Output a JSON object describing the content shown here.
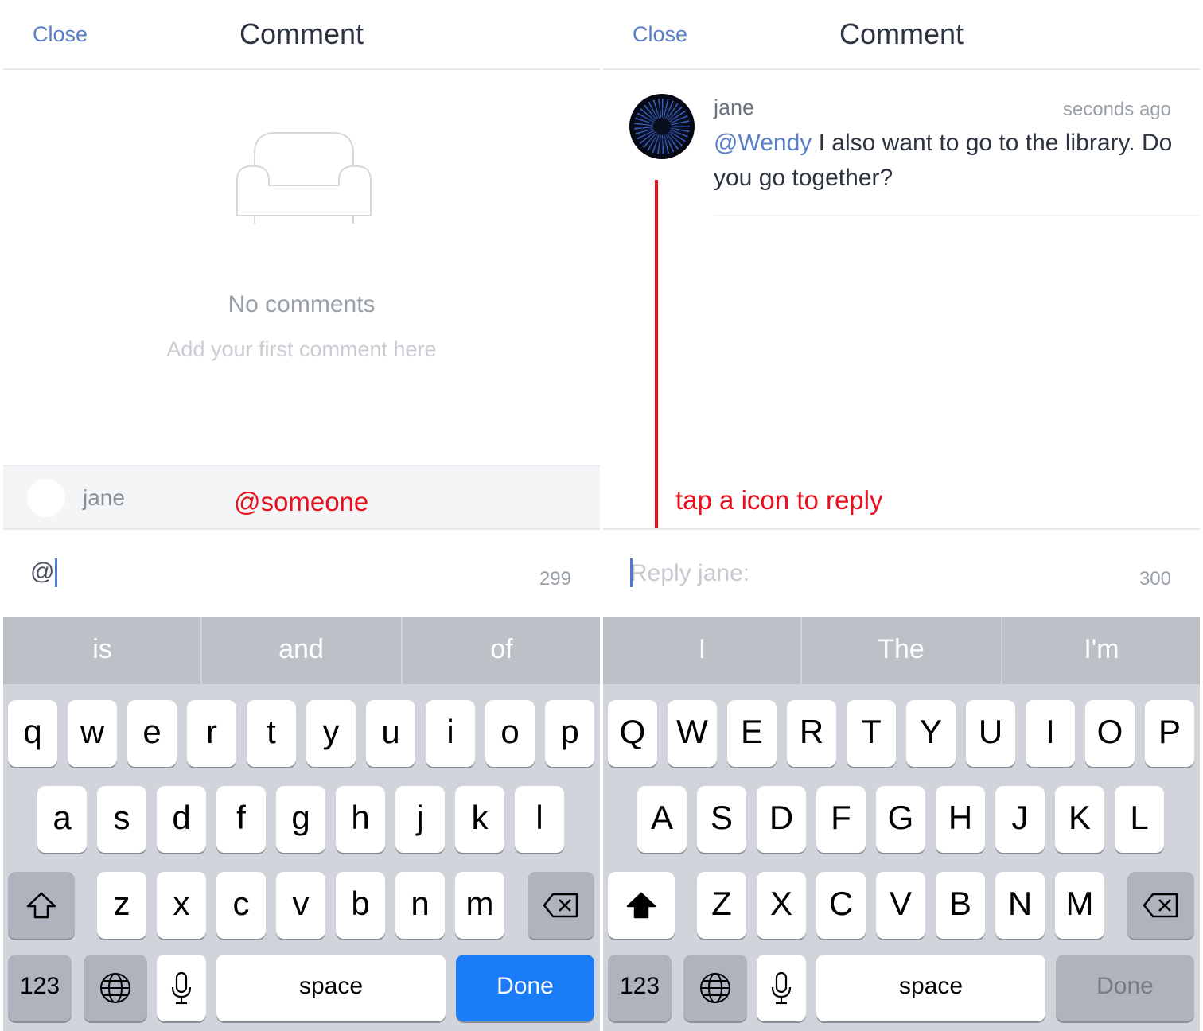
{
  "left": {
    "header": {
      "close_label": "Close",
      "title": "Comment"
    },
    "empty_state": {
      "title": "No comments",
      "subtitle": "Add your first comment here",
      "icon": "sofa-icon"
    },
    "mention_bar": {
      "name": "jane"
    },
    "annotation": "@someone",
    "input": {
      "value": "@",
      "counter": "299"
    },
    "keyboard": {
      "suggestions": [
        "is",
        "and",
        "of"
      ],
      "row1": [
        "q",
        "w",
        "e",
        "r",
        "t",
        "y",
        "u",
        "i",
        "o",
        "p"
      ],
      "row2": [
        "a",
        "s",
        "d",
        "f",
        "g",
        "h",
        "j",
        "k",
        "l"
      ],
      "row3": [
        "z",
        "x",
        "c",
        "v",
        "b",
        "n",
        "m"
      ],
      "numbers_label": "123",
      "space_label": "space",
      "done_label": "Done"
    }
  },
  "right": {
    "header": {
      "close_label": "Close",
      "title": "Comment"
    },
    "comment": {
      "user": "jane",
      "time": "seconds ago",
      "mention": "@Wendy",
      "text": "I also want to go to the library. Do you go together?"
    },
    "annotation": "tap a icon to reply",
    "input": {
      "placeholder": "Reply jane:",
      "counter": "300"
    },
    "keyboard": {
      "suggestions": [
        "I",
        "The",
        "I'm"
      ],
      "row1": [
        "Q",
        "W",
        "E",
        "R",
        "T",
        "Y",
        "U",
        "I",
        "O",
        "P"
      ],
      "row2": [
        "A",
        "S",
        "D",
        "F",
        "G",
        "H",
        "J",
        "K",
        "L"
      ],
      "row3": [
        "Z",
        "X",
        "C",
        "V",
        "B",
        "N",
        "M"
      ],
      "numbers_label": "123",
      "space_label": "space",
      "done_label": "Done"
    }
  },
  "colors": {
    "accent": "#5a7fc6",
    "annotation": "#e8101c",
    "done_blue": "#1a7cf6"
  }
}
